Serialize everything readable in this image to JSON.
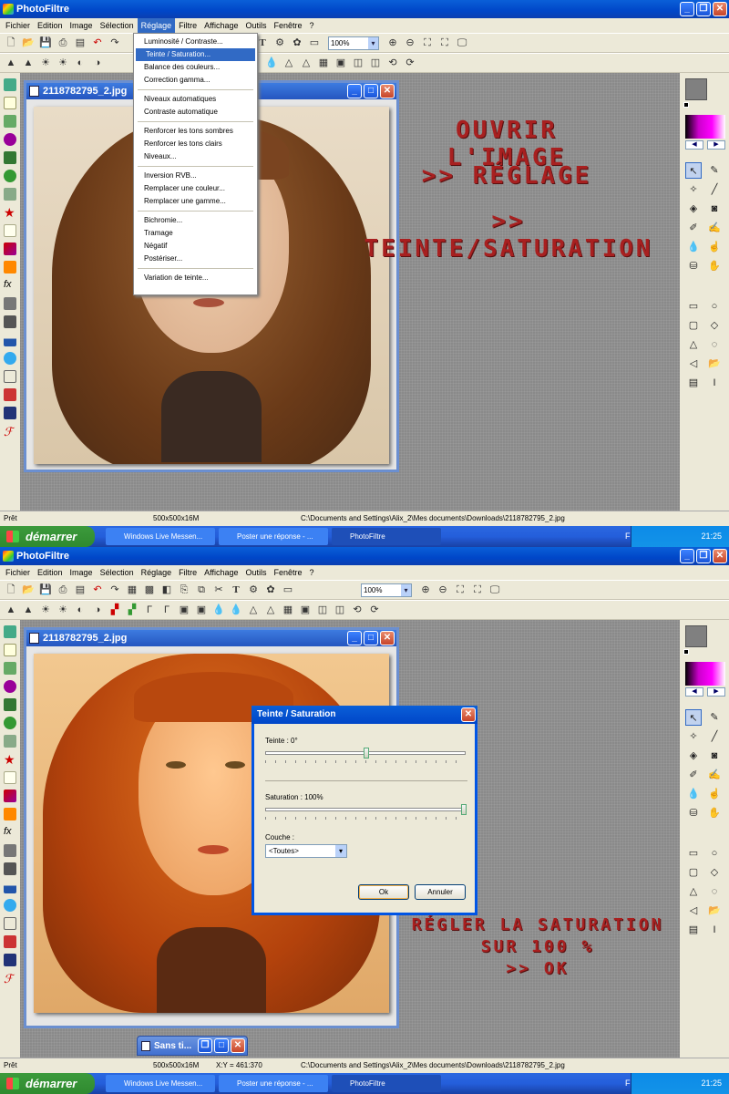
{
  "app": {
    "title": "PhotoFiltre"
  },
  "menu": [
    "Fichier",
    "Edition",
    "Image",
    "Sélection",
    "Réglage",
    "Filtre",
    "Affichage",
    "Outils",
    "Fenêtre",
    "?"
  ],
  "zoom": "100%",
  "image_window": {
    "title": "2118782795_2.jpg"
  },
  "reglage_menu": {
    "items": [
      {
        "label": "Luminosité / Contraste..."
      },
      {
        "label": "Teinte / Saturation...",
        "highlighted": true
      },
      {
        "label": "Balance des couleurs..."
      },
      {
        "label": "Correction gamma..."
      },
      {
        "sep": true
      },
      {
        "label": "Niveaux automatiques"
      },
      {
        "label": "Contraste automatique"
      },
      {
        "sep": true
      },
      {
        "label": "Renforcer les tons sombres"
      },
      {
        "label": "Renforcer les tons clairs"
      },
      {
        "label": "Niveaux..."
      },
      {
        "sep": true
      },
      {
        "label": "Inversion RVB..."
      },
      {
        "label": "Remplacer une couleur..."
      },
      {
        "label": "Remplacer une gamme..."
      },
      {
        "sep": true
      },
      {
        "label": "Bichromie..."
      },
      {
        "label": "Tramage"
      },
      {
        "label": "Négatif"
      },
      {
        "label": "Postériser..."
      },
      {
        "sep": true
      },
      {
        "label": "Variation de teinte..."
      }
    ]
  },
  "overlay_top": [
    "OUVRIR L'IMAGE",
    ">> RÉGLAGE",
    ">> TEINTE/SATURATION"
  ],
  "overlay_bottom": [
    "RÉGLER LA SATURATION",
    "SUR 100 %",
    ">> OK"
  ],
  "dialog": {
    "title": "Teinte / Saturation",
    "teinte_label": "Teinte : 0°",
    "teinte_value": 0,
    "saturation_label": "Saturation : 100%",
    "saturation_value": 100,
    "couche_label": "Couche :",
    "couche_value": "<Toutes>",
    "ok": "Ok",
    "cancel": "Annuler"
  },
  "minimized_window": {
    "title": "Sans ti..."
  },
  "status_top": {
    "state": "Prêt",
    "size": "500x500x16M",
    "path": "C:\\Documents and Settings\\Alix_2\\Mes documents\\Downloads\\2118782795_2.jpg"
  },
  "status_bottom": {
    "state": "Prêt",
    "size": "500x500x16M",
    "coords": "X:Y = 461:370",
    "path": "C:\\Documents and Settings\\Alix_2\\Mes documents\\Downloads\\2118782795_2.jpg"
  },
  "taskbar": {
    "start": "démarrer",
    "tasks": [
      "Windows Live Messen...",
      "Poster une réponse - ...",
      "PhotoFiltre"
    ],
    "lang": "FR",
    "time": "21:25"
  },
  "colors": {
    "accent": "#316ac5",
    "overlay_text": "#a82020",
    "workspace": "#8a8a8a"
  }
}
